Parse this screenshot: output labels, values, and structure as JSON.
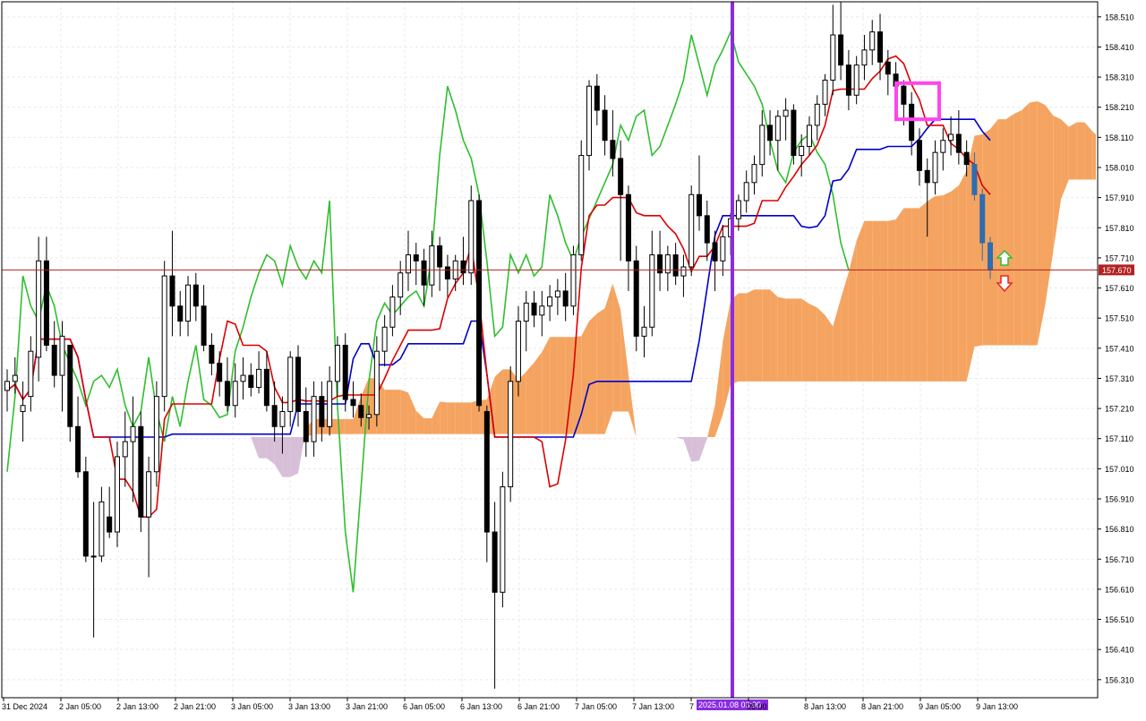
{
  "chart_data": {
    "type": "candlestick",
    "symbol_current_price": "157.670",
    "y_axis": {
      "range": [
        156.25,
        158.56
      ],
      "ticks": [
        "158.510",
        "158.410",
        "158.310",
        "158.210",
        "158.110",
        "158.010",
        "157.910",
        "157.810",
        "157.710",
        "157.610",
        "157.510",
        "157.410",
        "157.310",
        "157.210",
        "157.110",
        "157.010",
        "156.910",
        "156.810",
        "156.710",
        "156.610",
        "156.510",
        "156.410",
        "156.310"
      ]
    },
    "x_axis": {
      "ticks": [
        "31 Dec 2024",
        "2 Jan 05:00",
        "2 Jan 13:00",
        "2 Jan 21:00",
        "3 Jan 05:00",
        "3 Jan 13:00",
        "3 Jan 21:00",
        "6 Jan 05:00",
        "6 Jan 13:00",
        "6 Jan 21:00",
        "7 Jan 05:00",
        "7 Jan 13:00",
        "7",
        "05:00",
        "8 Jan 13:00",
        "8 Jan 21:00",
        "9 Jan 05:00",
        "9 Jan 13:00"
      ],
      "highlight_label": "2025.01.08 03:00"
    },
    "grid": true,
    "current_price_line": 157.67,
    "markers": {
      "vertical_line_label": "2025.01.08 03:00",
      "box": {
        "y_top": 158.29,
        "y_bottom": 158.17
      },
      "arrow_up": "buy",
      "arrow_down": "sell"
    },
    "candles": [
      {
        "o": 157.27,
        "h": 157.34,
        "l": 157.2,
        "c": 157.3
      },
      {
        "o": 157.3,
        "h": 157.38,
        "l": 157.26,
        "c": 157.32
      },
      {
        "o": 157.2,
        "h": 157.3,
        "l": 157.1,
        "c": 157.22
      },
      {
        "o": 157.25,
        "h": 157.45,
        "l": 157.2,
        "c": 157.4
      },
      {
        "o": 157.38,
        "h": 157.78,
        "l": 157.3,
        "c": 157.7
      },
      {
        "o": 157.7,
        "h": 157.78,
        "l": 157.4,
        "c": 157.42
      },
      {
        "o": 157.42,
        "h": 157.5,
        "l": 157.28,
        "c": 157.32
      },
      {
        "o": 157.32,
        "h": 157.5,
        "l": 157.2,
        "c": 157.45
      },
      {
        "o": 157.42,
        "h": 157.42,
        "l": 157.1,
        "c": 157.15
      },
      {
        "o": 157.15,
        "h": 157.25,
        "l": 156.98,
        "c": 157.0
      },
      {
        "o": 157.0,
        "h": 157.05,
        "l": 156.7,
        "c": 156.72
      },
      {
        "o": 156.72,
        "h": 156.9,
        "l": 156.45,
        "c": 156.72
      },
      {
        "o": 156.72,
        "h": 156.95,
        "l": 156.7,
        "c": 156.9
      },
      {
        "o": 156.85,
        "h": 156.95,
        "l": 156.78,
        "c": 156.8
      },
      {
        "o": 156.8,
        "h": 157.1,
        "l": 156.75,
        "c": 157.05
      },
      {
        "o": 157.05,
        "h": 157.2,
        "l": 156.95,
        "c": 157.1
      },
      {
        "o": 157.1,
        "h": 157.25,
        "l": 156.9,
        "c": 157.15
      },
      {
        "o": 157.15,
        "h": 157.2,
        "l": 156.8,
        "c": 156.85
      },
      {
        "o": 156.85,
        "h": 157.05,
        "l": 156.65,
        "c": 157.0
      },
      {
        "o": 157.0,
        "h": 157.3,
        "l": 156.95,
        "c": 157.25
      },
      {
        "o": 157.25,
        "h": 157.7,
        "l": 157.2,
        "c": 157.65
      },
      {
        "o": 157.65,
        "h": 157.8,
        "l": 157.45,
        "c": 157.55
      },
      {
        "o": 157.55,
        "h": 157.6,
        "l": 157.45,
        "c": 157.5
      },
      {
        "o": 157.5,
        "h": 157.65,
        "l": 157.45,
        "c": 157.62
      },
      {
        "o": 157.62,
        "h": 157.66,
        "l": 157.5,
        "c": 157.55
      },
      {
        "o": 157.55,
        "h": 157.62,
        "l": 157.4,
        "c": 157.42
      },
      {
        "o": 157.42,
        "h": 157.46,
        "l": 157.32,
        "c": 157.36
      },
      {
        "o": 157.36,
        "h": 157.4,
        "l": 157.25,
        "c": 157.3
      },
      {
        "o": 157.3,
        "h": 157.38,
        "l": 157.2,
        "c": 157.22
      },
      {
        "o": 157.22,
        "h": 157.36,
        "l": 157.18,
        "c": 157.3
      },
      {
        "o": 157.3,
        "h": 157.38,
        "l": 157.24,
        "c": 157.32
      },
      {
        "o": 157.32,
        "h": 157.36,
        "l": 157.25,
        "c": 157.28
      },
      {
        "o": 157.28,
        "h": 157.4,
        "l": 157.26,
        "c": 157.34
      },
      {
        "o": 157.34,
        "h": 157.4,
        "l": 157.2,
        "c": 157.22
      },
      {
        "o": 157.22,
        "h": 157.3,
        "l": 157.1,
        "c": 157.15
      },
      {
        "o": 157.15,
        "h": 157.25,
        "l": 157.06,
        "c": 157.2
      },
      {
        "o": 157.2,
        "h": 157.4,
        "l": 157.15,
        "c": 157.38
      },
      {
        "o": 157.38,
        "h": 157.42,
        "l": 157.15,
        "c": 157.2
      },
      {
        "o": 157.2,
        "h": 157.28,
        "l": 157.05,
        "c": 157.1
      },
      {
        "o": 157.1,
        "h": 157.3,
        "l": 157.05,
        "c": 157.25
      },
      {
        "o": 157.25,
        "h": 157.3,
        "l": 157.1,
        "c": 157.15
      },
      {
        "o": 157.15,
        "h": 157.35,
        "l": 157.12,
        "c": 157.3
      },
      {
        "o": 157.3,
        "h": 157.45,
        "l": 157.25,
        "c": 157.42
      },
      {
        "o": 157.42,
        "h": 157.46,
        "l": 157.2,
        "c": 157.24
      },
      {
        "o": 157.24,
        "h": 157.3,
        "l": 157.18,
        "c": 157.22
      },
      {
        "o": 157.22,
        "h": 157.26,
        "l": 157.15,
        "c": 157.18
      },
      {
        "o": 157.18,
        "h": 157.22,
        "l": 157.14,
        "c": 157.19
      },
      {
        "o": 157.19,
        "h": 157.45,
        "l": 157.15,
        "c": 157.4
      },
      {
        "o": 157.4,
        "h": 157.52,
        "l": 157.35,
        "c": 157.48
      },
      {
        "o": 157.48,
        "h": 157.62,
        "l": 157.45,
        "c": 157.58
      },
      {
        "o": 157.58,
        "h": 157.7,
        "l": 157.52,
        "c": 157.66
      },
      {
        "o": 157.66,
        "h": 157.8,
        "l": 157.6,
        "c": 157.72
      },
      {
        "o": 157.72,
        "h": 157.76,
        "l": 157.62,
        "c": 157.7
      },
      {
        "o": 157.7,
        "h": 157.74,
        "l": 157.55,
        "c": 157.62
      },
      {
        "o": 157.62,
        "h": 157.8,
        "l": 157.58,
        "c": 157.75
      },
      {
        "o": 157.75,
        "h": 157.78,
        "l": 157.6,
        "c": 157.68
      },
      {
        "o": 157.68,
        "h": 157.72,
        "l": 157.58,
        "c": 157.64
      },
      {
        "o": 157.64,
        "h": 157.72,
        "l": 157.6,
        "c": 157.7
      },
      {
        "o": 157.7,
        "h": 157.78,
        "l": 157.62,
        "c": 157.66
      },
      {
        "o": 157.66,
        "h": 157.95,
        "l": 157.62,
        "c": 157.9
      },
      {
        "o": 157.9,
        "h": 157.92,
        "l": 157.2,
        "c": 157.22
      },
      {
        "o": 157.2,
        "h": 157.22,
        "l": 156.7,
        "c": 156.8
      },
      {
        "o": 156.8,
        "h": 156.9,
        "l": 156.28,
        "c": 156.6
      },
      {
        "o": 156.6,
        "h": 157.0,
        "l": 156.55,
        "c": 156.95
      },
      {
        "o": 156.95,
        "h": 157.35,
        "l": 156.9,
        "c": 157.3
      },
      {
        "o": 157.3,
        "h": 157.55,
        "l": 157.25,
        "c": 157.5
      },
      {
        "o": 157.5,
        "h": 157.6,
        "l": 157.4,
        "c": 157.56
      },
      {
        "o": 157.56,
        "h": 157.6,
        "l": 157.48,
        "c": 157.52
      },
      {
        "o": 157.52,
        "h": 157.6,
        "l": 157.45,
        "c": 157.55
      },
      {
        "o": 157.55,
        "h": 157.62,
        "l": 157.5,
        "c": 157.58
      },
      {
        "o": 157.58,
        "h": 157.64,
        "l": 157.52,
        "c": 157.6
      },
      {
        "o": 157.6,
        "h": 157.66,
        "l": 157.5,
        "c": 157.55
      },
      {
        "o": 157.55,
        "h": 157.75,
        "l": 157.52,
        "c": 157.72
      },
      {
        "o": 157.72,
        "h": 158.1,
        "l": 157.7,
        "c": 158.05
      },
      {
        "o": 158.05,
        "h": 158.3,
        "l": 158.0,
        "c": 158.28
      },
      {
        "o": 158.28,
        "h": 158.32,
        "l": 158.15,
        "c": 158.2
      },
      {
        "o": 158.2,
        "h": 158.25,
        "l": 158.05,
        "c": 158.1
      },
      {
        "o": 158.1,
        "h": 158.2,
        "l": 157.98,
        "c": 158.04
      },
      {
        "o": 158.04,
        "h": 158.1,
        "l": 157.7,
        "c": 157.92
      },
      {
        "o": 157.92,
        "h": 157.95,
        "l": 157.6,
        "c": 157.7
      },
      {
        "o": 157.7,
        "h": 157.75,
        "l": 157.4,
        "c": 157.45
      },
      {
        "o": 157.45,
        "h": 157.55,
        "l": 157.38,
        "c": 157.48
      },
      {
        "o": 157.48,
        "h": 157.8,
        "l": 157.45,
        "c": 157.72
      },
      {
        "o": 157.72,
        "h": 157.8,
        "l": 157.6,
        "c": 157.66
      },
      {
        "o": 157.66,
        "h": 157.75,
        "l": 157.6,
        "c": 157.72
      },
      {
        "o": 157.72,
        "h": 157.76,
        "l": 157.62,
        "c": 157.65
      },
      {
        "o": 157.65,
        "h": 157.72,
        "l": 157.58,
        "c": 157.68
      },
      {
        "o": 157.68,
        "h": 157.95,
        "l": 157.65,
        "c": 157.92
      },
      {
        "o": 157.92,
        "h": 158.05,
        "l": 157.8,
        "c": 157.85
      },
      {
        "o": 157.85,
        "h": 157.9,
        "l": 157.7,
        "c": 157.76
      },
      {
        "o": 157.76,
        "h": 157.8,
        "l": 157.6,
        "c": 157.7
      },
      {
        "o": 157.7,
        "h": 157.82,
        "l": 157.65,
        "c": 157.78
      },
      {
        "o": 157.78,
        "h": 157.86,
        "l": 157.72,
        "c": 157.84
      },
      {
        "o": 157.84,
        "h": 157.92,
        "l": 157.8,
        "c": 157.9
      },
      {
        "o": 157.9,
        "h": 158.0,
        "l": 157.86,
        "c": 157.96
      },
      {
        "o": 157.96,
        "h": 158.05,
        "l": 157.92,
        "c": 158.02
      },
      {
        "o": 158.02,
        "h": 158.2,
        "l": 157.98,
        "c": 158.15
      },
      {
        "o": 158.15,
        "h": 158.2,
        "l": 158.05,
        "c": 158.1
      },
      {
        "o": 158.1,
        "h": 158.2,
        "l": 158.0,
        "c": 158.18
      },
      {
        "o": 158.18,
        "h": 158.24,
        "l": 158.1,
        "c": 158.2
      },
      {
        "o": 158.2,
        "h": 158.22,
        "l": 158.02,
        "c": 158.05
      },
      {
        "o": 158.05,
        "h": 158.12,
        "l": 157.98,
        "c": 158.08
      },
      {
        "o": 158.08,
        "h": 158.18,
        "l": 158.05,
        "c": 158.15
      },
      {
        "o": 158.15,
        "h": 158.25,
        "l": 158.1,
        "c": 158.22
      },
      {
        "o": 158.22,
        "h": 158.32,
        "l": 158.18,
        "c": 158.3
      },
      {
        "o": 158.3,
        "h": 158.55,
        "l": 158.25,
        "c": 158.45
      },
      {
        "o": 158.45,
        "h": 158.56,
        "l": 158.3,
        "c": 158.35
      },
      {
        "o": 158.35,
        "h": 158.4,
        "l": 158.2,
        "c": 158.25
      },
      {
        "o": 158.25,
        "h": 158.38,
        "l": 158.22,
        "c": 158.35
      },
      {
        "o": 158.35,
        "h": 158.45,
        "l": 158.3,
        "c": 158.4
      },
      {
        "o": 158.4,
        "h": 158.5,
        "l": 158.35,
        "c": 158.46
      },
      {
        "o": 158.46,
        "h": 158.52,
        "l": 158.3,
        "c": 158.36
      },
      {
        "o": 158.36,
        "h": 158.4,
        "l": 158.25,
        "c": 158.32
      },
      {
        "o": 158.32,
        "h": 158.36,
        "l": 158.2,
        "c": 158.28
      },
      {
        "o": 158.28,
        "h": 158.3,
        "l": 158.15,
        "c": 158.22
      },
      {
        "o": 158.22,
        "h": 158.26,
        "l": 158.05,
        "c": 158.1
      },
      {
        "o": 158.1,
        "h": 158.14,
        "l": 157.95,
        "c": 158.0
      },
      {
        "o": 158.0,
        "h": 158.04,
        "l": 157.78,
        "c": 157.96
      },
      {
        "o": 157.96,
        "h": 158.1,
        "l": 157.92,
        "c": 158.06
      },
      {
        "o": 158.06,
        "h": 158.14,
        "l": 158.0,
        "c": 158.1
      },
      {
        "o": 158.1,
        "h": 158.18,
        "l": 158.05,
        "c": 158.12
      },
      {
        "o": 158.12,
        "h": 158.2,
        "l": 158.02,
        "c": 158.06
      },
      {
        "o": 158.06,
        "h": 158.1,
        "l": 157.98,
        "c": 158.02
      },
      {
        "o": 158.02,
        "h": 158.06,
        "l": 157.9,
        "c": 157.92
      },
      {
        "o": 157.92,
        "h": 157.94,
        "l": 157.7,
        "c": 157.76
      },
      {
        "o": 157.76,
        "h": 157.78,
        "l": 157.64,
        "c": 157.67
      }
    ]
  }
}
